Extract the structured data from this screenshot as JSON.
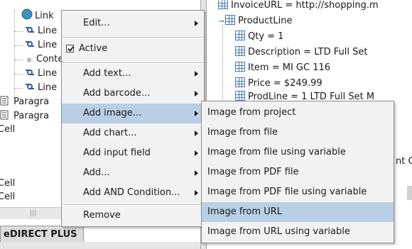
{
  "left_tree": {
    "rows": [
      {
        "label": "Link",
        "icon": "globe-icon"
      },
      {
        "label": "Line",
        "icon": "link-icon"
      },
      {
        "label": "Line",
        "icon": "link-icon"
      },
      {
        "label": "Conte",
        "icon": "asterisk-icon"
      },
      {
        "label": "Line",
        "icon": "link-icon"
      },
      {
        "label": "Line",
        "icon": "link-icon"
      },
      {
        "label": "Paragra",
        "icon": "document-icon"
      },
      {
        "label": "Paragra",
        "icon": "document-icon"
      },
      {
        "label": "Cell",
        "icon": ""
      },
      {
        "label": "Cell",
        "icon": ""
      },
      {
        "label": "Cell",
        "icon": ""
      }
    ],
    "bottom_tab": "eDIRECT PLUS",
    "scroll_grip": "|||"
  },
  "right_tree": {
    "rows": [
      {
        "label": "InvoiceURL = http://shopping.m"
      },
      {
        "label": "ProductLine"
      },
      {
        "label": "Qty = 1"
      },
      {
        "label": "Description = LTD Full Set"
      },
      {
        "label": "Item = MI GC 116"
      },
      {
        "label": "Price = $249.99"
      },
      {
        "label": "ProdLine = 1 LTD Full Set M"
      },
      {
        "label": "nt C"
      }
    ]
  },
  "context_menu": {
    "items": [
      {
        "label": "Edit...",
        "submenu": true
      },
      {
        "label": "Active",
        "checked": true
      },
      {
        "label": "Add text...",
        "submenu": true
      },
      {
        "label": "Add barcode...",
        "submenu": true
      },
      {
        "label": "Add image...",
        "submenu": true,
        "active": true
      },
      {
        "label": "Add chart...",
        "submenu": true
      },
      {
        "label": "Add input field",
        "submenu": true
      },
      {
        "label": "Add...",
        "submenu": true
      },
      {
        "label": "Add AND Condition...",
        "submenu": true
      },
      {
        "label": "Remove",
        "submenu": false
      }
    ]
  },
  "image_submenu": {
    "items": [
      {
        "label": "Image from project"
      },
      {
        "label": "Image from file"
      },
      {
        "label": "Image from file using variable"
      },
      {
        "label": "Image from PDF file"
      },
      {
        "label": "Image from PDF file using variable"
      },
      {
        "label": "Image from URL",
        "active": true
      },
      {
        "label": "Image from URL using variable"
      }
    ]
  },
  "colors": {
    "menu_bg": "#f2f2f2",
    "highlight": "#b8cfe5",
    "menu_border": "#8e8e8e"
  }
}
